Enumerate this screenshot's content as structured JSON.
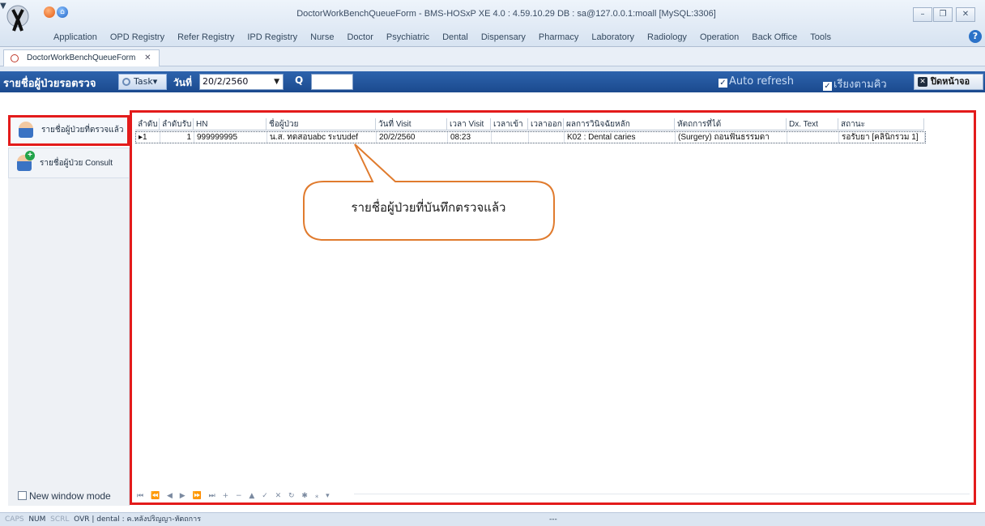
{
  "window": {
    "title": "DoctorWorkBenchQueueForm - BMS-HOSxP XE 4.0 : 4.59.10.29 DB : sa@127.0.0.1:moall [MySQL:3306]",
    "controls": [
      "–",
      "❐",
      "✕"
    ]
  },
  "quick_access": {
    "dropdown": "▼"
  },
  "ribbon": {
    "tabs": [
      "Application",
      "OPD Registry",
      "Refer Registry",
      "IPD Registry",
      "Nurse",
      "Doctor",
      "Psychiatric",
      "Dental",
      "Dispensary",
      "Pharmacy",
      "Laboratory",
      "Radiology",
      "Operation",
      "Back Office",
      "Tools"
    ],
    "help": "?"
  },
  "doc_tab": {
    "label": "DoctorWorkBenchQueueForm",
    "close": "✕"
  },
  "toolbar": {
    "title": "รายชื่อผู้ป่วยรอตรวจ",
    "task_label": "Task▾",
    "date_label": "วันที่",
    "date_value": "20/2/2560",
    "date_arrow": "▼",
    "q_label": "Q",
    "auto_refresh": "Auto refresh",
    "sort_queue": "เรียงตามคิว",
    "check_mark": "✓",
    "close_label": "ปิดหน้าจอ",
    "close_icon": "✕"
  },
  "sidebar": {
    "items": [
      {
        "label": "รายชื่อผู้ป่วยที่ตรวจแล้ว",
        "icon": "doctor-icon",
        "selected": true
      },
      {
        "label": "รายชื่อผู้ป่วย Consult",
        "icon": "doctor-add-icon",
        "plus": "+"
      }
    ],
    "new_window_mode": "New window mode"
  },
  "grid": {
    "columns": [
      "ลำดับ",
      "ลำดับรับ",
      "HN",
      "ชื่อผู้ป่วย",
      "วันที่ Visit",
      "เวลา Visit",
      "เวลาเข้า",
      "เวลาออก",
      "ผลการวินิจฉัยหลัก",
      "หัตถการที่ได้",
      "Dx. Text",
      "สถานะ"
    ],
    "rows": [
      [
        "1",
        "1",
        "999999995",
        "น.ส. ทดสอบabc ระบบdef",
        "20/2/2560",
        "08:23",
        "",
        "",
        "K02 : Dental caries",
        "(Surgery) ถอนฟันธรรมดา",
        "",
        "รอรับยา [คลินิกรวม 1]"
      ]
    ],
    "row_indicator": "▸",
    "navigator": "⏮ ⏪ ◀ ▶ ⏩ ⏭ + − ▲ ✓ ✕ ↻ ✱ ⁎ ▾"
  },
  "callout": {
    "text": "รายชื่อผู้ป่วยที่บันทึกตรวจแล้ว"
  },
  "status_bar": {
    "caps": "CAPS",
    "num": "NUM",
    "scrl": "SCRL",
    "ovr": "OVR",
    "dept": "dental : ค.หลังปริญญา-หัตถการ",
    "extra": "---"
  },
  "colors": {
    "accent_red": "#e31b1b",
    "toolbar_blue": "#1b4a8e"
  }
}
